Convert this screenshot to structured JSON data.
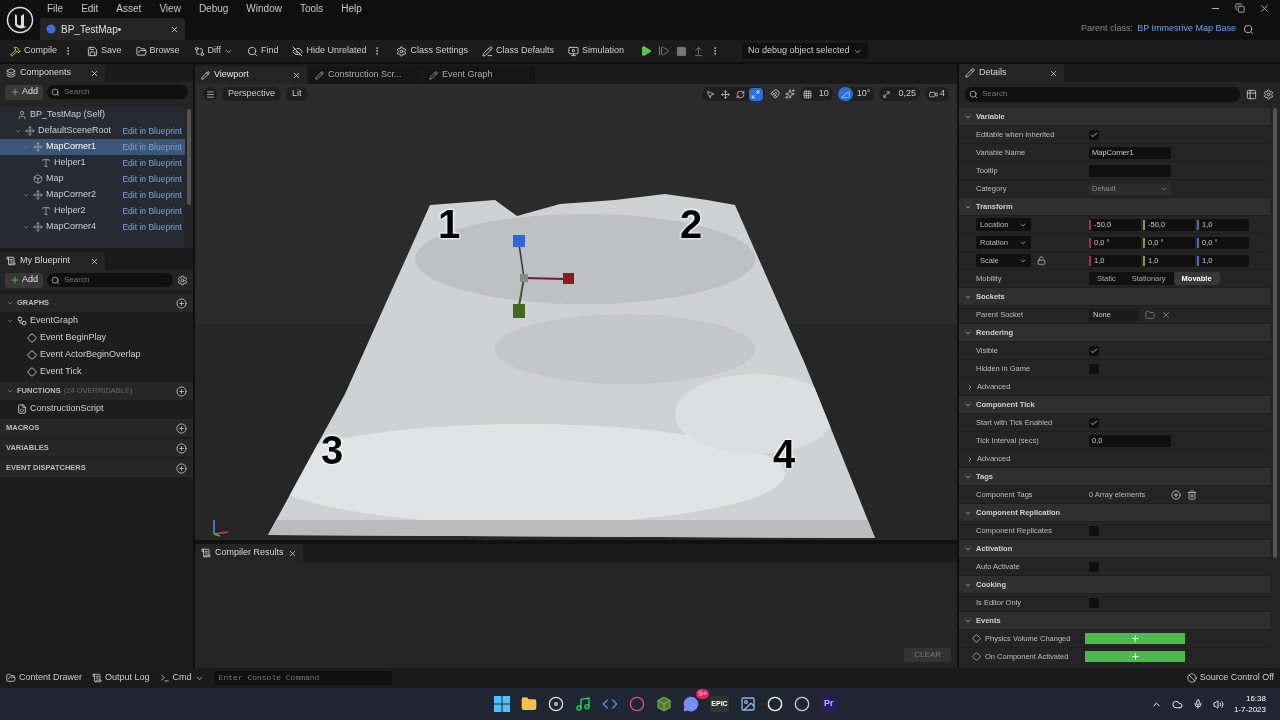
{
  "app": {
    "menu": [
      "File",
      "Edit",
      "Asset",
      "View",
      "Debug",
      "Window",
      "Tools",
      "Help"
    ],
    "document_tab": "BP_TestMap•",
    "parent_class_label": "Parent class:",
    "parent_class": "BP Immesrive Map Base"
  },
  "toolbar": {
    "buttons": [
      {
        "label": "Compile",
        "more": true,
        "dropdown": false
      },
      {
        "label": "Save",
        "more": false,
        "dropdown": false
      },
      {
        "label": "Browse",
        "more": false,
        "dropdown": false
      },
      {
        "label": "Diff",
        "more": false,
        "dropdown": true
      },
      {
        "label": "Find",
        "more": false,
        "dropdown": false
      },
      {
        "label": "Hide Unrelated",
        "more": true,
        "dropdown": false
      },
      {
        "label": "Class Settings",
        "more": false,
        "dropdown": false
      },
      {
        "label": "Class Defaults",
        "more": false,
        "dropdown": false
      },
      {
        "label": "Simulation",
        "more": false,
        "dropdown": false
      }
    ],
    "debug_filter": "No debug object selected"
  },
  "components": {
    "title": "Components",
    "add": "Add",
    "search_placeholder": "Search",
    "tree": [
      {
        "label": "BP_TestMap (Self)",
        "kind": "self",
        "selected": false,
        "children": [
          {
            "label": "DefaultSceneRoot",
            "kind": "scene",
            "link": "Edit in Blueprint",
            "expanded": true,
            "selected": false,
            "children": [
              {
                "label": "MapCorner1",
                "kind": "scene",
                "link": "Edit in Blueprint",
                "expanded": true,
                "selected": true,
                "children": [
                  {
                    "label": "Helper1",
                    "kind": "text",
                    "link": "Edit in Blueprint",
                    "selected": false
                  }
                ]
              },
              {
                "label": "Map",
                "kind": "mesh",
                "link": "Edit in Blueprint",
                "selected": false
              },
              {
                "label": "MapCorner2",
                "kind": "scene",
                "link": "Edit in Blueprint",
                "expanded": true,
                "selected": false,
                "children": [
                  {
                    "label": "Helper2",
                    "kind": "text",
                    "link": "Edit in Blueprint",
                    "selected": false
                  }
                ]
              },
              {
                "label": "MapCorner4",
                "kind": "scene",
                "link": "Edit in Blueprint",
                "expanded": true,
                "selected": false
              }
            ]
          }
        ]
      }
    ]
  },
  "my_blueprint": {
    "title": "My Blueprint",
    "add": "Add",
    "search_placeholder": "Search",
    "sections": [
      {
        "title": "GRAPHS",
        "items": [
          {
            "label": "EventGraph",
            "kind": "graph",
            "expanded": true,
            "children": [
              {
                "label": "Event BeginPlay",
                "kind": "event"
              },
              {
                "label": "Event ActorBeginOverlap",
                "kind": "event"
              },
              {
                "label": "Event Tick",
                "kind": "event"
              }
            ]
          }
        ]
      },
      {
        "title": "FUNCTIONS",
        "note": "(24 OVERRIDABLE)",
        "items": [
          {
            "label": "ConstructionScript",
            "kind": "function"
          }
        ]
      },
      {
        "title": "MACROS"
      },
      {
        "title": "VARIABLES"
      },
      {
        "title": "EVENT DISPATCHERS"
      }
    ]
  },
  "editor_tabs": [
    {
      "label": "Viewport",
      "selected": true,
      "closable": true
    },
    {
      "label": "Construction Scr...",
      "selected": false
    },
    {
      "label": "Event Graph",
      "selected": false
    }
  ],
  "viewport": {
    "view_buttons": [
      "Perspective",
      "Lit"
    ],
    "tools": [
      {
        "selected": false
      },
      {
        "selected": false
      },
      {
        "selected": false
      },
      {
        "selected": true
      }
    ],
    "snaps": [
      {
        "value": "10",
        "on": false
      },
      {
        "value": "10°",
        "on": true
      },
      {
        "value": "0,25",
        "on": false
      }
    ],
    "camera_speed": "4",
    "corner_labels": [
      "1",
      "2",
      "3",
      "4"
    ]
  },
  "compiler_results": {
    "title": "Compiler Results",
    "clear": "CLEAR"
  },
  "details": {
    "title": "Details",
    "search_placeholder": "Search",
    "sections": [
      {
        "title": "Variable",
        "expanded": true,
        "rows": [
          {
            "kind": "checkbox",
            "label": "Editable when Inherited",
            "checked": true
          },
          {
            "kind": "text",
            "label": "Variable Name",
            "value": "MapCorner1"
          },
          {
            "kind": "text",
            "label": "Tooltip"
          },
          {
            "kind": "combo",
            "label": "Category",
            "value": "Default",
            "disabled": true
          }
        ]
      },
      {
        "title": "Transform",
        "expanded": true,
        "rows": [
          {
            "kind": "vector",
            "label": "Location",
            "values": [
              "-50,0",
              "-50,0",
              "1,0"
            ]
          },
          {
            "kind": "vector",
            "label": "Rotation",
            "values": [
              "0,0 °",
              "0,0 °",
              "0,0 °"
            ]
          },
          {
            "kind": "vector",
            "label": "Scale",
            "locked": false,
            "values": [
              "1,0",
              "1,0",
              "1,0"
            ]
          },
          {
            "kind": "segmented",
            "label": "Mobility",
            "options": [
              {
                "label": "Static",
                "selected": false
              },
              {
                "label": "Stationary",
                "selected": false
              },
              {
                "label": "Movable",
                "selected": true
              }
            ]
          }
        ]
      },
      {
        "title": "Sockets",
        "expanded": true,
        "rows": [
          {
            "kind": "socket",
            "label": "Parent Socket",
            "value": "None"
          }
        ]
      },
      {
        "title": "Rendering",
        "expanded": true,
        "rows": [
          {
            "kind": "checkbox",
            "label": "Visible",
            "checked": true
          },
          {
            "kind": "checkbox",
            "label": "Hidden in Game",
            "checked": false
          },
          {
            "kind": "subsection",
            "label": "Advanced",
            "expanded": false
          }
        ]
      },
      {
        "title": "Component Tick",
        "expanded": true,
        "rows": [
          {
            "kind": "checkbox",
            "label": "Start with Tick Enabled",
            "checked": true
          },
          {
            "kind": "text",
            "label": "Tick Interval (secs)",
            "value": "0,0"
          },
          {
            "kind": "subsection",
            "label": "Advanced",
            "expanded": false
          }
        ]
      },
      {
        "title": "Tags",
        "expanded": true,
        "rows": [
          {
            "kind": "array",
            "label": "Component Tags",
            "value": "0 Array elements"
          }
        ]
      },
      {
        "title": "Component Replication",
        "expanded": true,
        "rows": [
          {
            "kind": "checkbox",
            "label": "Component Replicates",
            "checked": false
          }
        ]
      },
      {
        "title": "Activation",
        "expanded": true,
        "rows": [
          {
            "kind": "checkbox",
            "label": "Auto Activate",
            "checked": false
          }
        ]
      },
      {
        "title": "Cooking",
        "expanded": true,
        "rows": [
          {
            "kind": "checkbox",
            "label": "Is Editor Only",
            "checked": false
          }
        ]
      },
      {
        "title": "Events",
        "expanded": true,
        "rows": [
          {
            "kind": "event",
            "label": "Physics Volume Changed"
          },
          {
            "kind": "event",
            "label": "On Component Activated"
          }
        ]
      }
    ]
  },
  "status_bar": {
    "buttons": [
      "Content Drawer",
      "Output Log",
      "Cmd"
    ],
    "console_placeholder": "Enter Console Command",
    "source_control": "Source Control Off"
  },
  "taskbar": {
    "apps": [
      {
        "kind": "start"
      },
      {
        "kind": "folder"
      },
      {
        "kind": "chat"
      },
      {
        "kind": "music"
      },
      {
        "kind": "code"
      },
      {
        "kind": "ring"
      },
      {
        "kind": "cube"
      },
      {
        "kind": "discord",
        "badge": "9+"
      },
      {
        "kind": "epic",
        "glyph": "EPIC"
      },
      {
        "kind": "photos"
      },
      {
        "kind": "unreal"
      },
      {
        "kind": "recorder"
      },
      {
        "kind": "premiere",
        "glyph": "Pr"
      }
    ],
    "time": "16:38",
    "date": "1-7-2023"
  }
}
